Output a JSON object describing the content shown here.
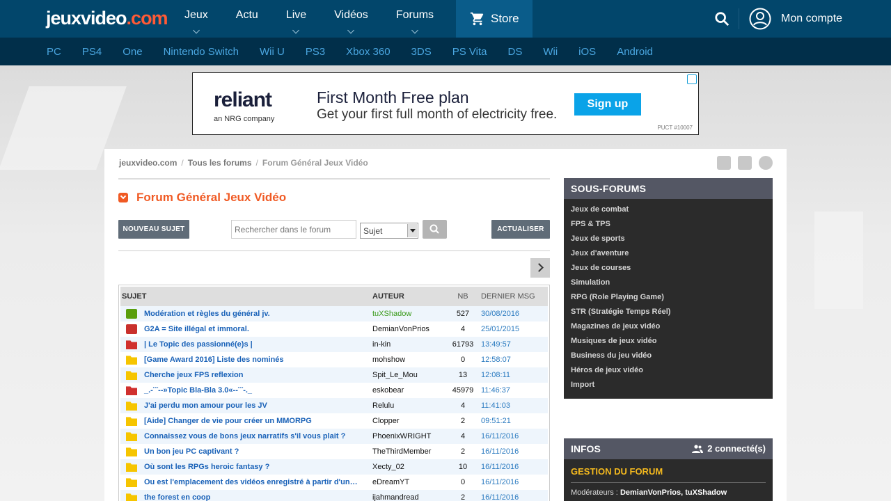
{
  "header": {
    "logo_main": "jeuxvideo",
    "logo_suffix": ".com",
    "nav": [
      {
        "label": "Jeux",
        "has_menu": true
      },
      {
        "label": "Actu",
        "has_menu": false
      },
      {
        "label": "Live",
        "has_menu": true
      },
      {
        "label": "Vidéos",
        "has_menu": true
      },
      {
        "label": "Forums",
        "has_menu": true
      }
    ],
    "store_label": "Store",
    "account_label": "Mon compte"
  },
  "platforms": [
    "PC",
    "PS4",
    "One",
    "Nintendo Switch",
    "Wii U",
    "PS3",
    "Xbox 360",
    "3DS",
    "PS Vita",
    "DS",
    "Wii",
    "iOS",
    "Android"
  ],
  "ad": {
    "brand": "reliant",
    "brand_sub": "an NRG company",
    "headline": "First Month Free plan",
    "subline": "Get your first full month of electricity free.",
    "cta": "Sign up",
    "fine_print": "PUCT #10007"
  },
  "breadcrumb": [
    "jeuxvideo.com",
    "Tous les forums",
    "Forum Général Jeux Vidéo"
  ],
  "forum": {
    "title": "Forum Général Jeux Vidéo",
    "new_topic": "NOUVEAU SUJET",
    "search_placeholder": "Rechercher dans le forum",
    "search_scope": "Sujet",
    "refresh": "ACTUALISER"
  },
  "table": {
    "headers": {
      "subject": "SUJET",
      "author": "AUTEUR",
      "nb": "NB",
      "last": "DERNIER MSG"
    },
    "rows": [
      {
        "icon": "pin-green",
        "subject": "Modération et règles du général jv.",
        "author": "tuXShadow",
        "author_mod": true,
        "nb": "527",
        "last": "30/08/2016"
      },
      {
        "icon": "pin-red",
        "subject": "G2A = Site illégal et immoral.",
        "author": "DemianVonPrios",
        "author_mod": false,
        "nb": "4",
        "last": "25/01/2015"
      },
      {
        "icon": "folder-red",
        "subject": "| Le Topic des passionné(e)s |",
        "author": "in-kin",
        "author_mod": false,
        "nb": "61793",
        "last": "13:49:57"
      },
      {
        "icon": "folder-yellow",
        "subject": "[Game Award 2016] Liste des nominés",
        "author": "mohshow",
        "author_mod": false,
        "nb": "0",
        "last": "12:58:07"
      },
      {
        "icon": "folder-yellow",
        "subject": "Cherche jeux FPS reflexion",
        "author": "Spit_Le_Mou",
        "author_mod": false,
        "nb": "13",
        "last": "12:08:11"
      },
      {
        "icon": "folder-red",
        "subject": "_.-¨¨--»Topic Bla-Bla 3.0«--¨¨-._",
        "author": "eskobear",
        "author_mod": false,
        "nb": "45979",
        "last": "11:46:37"
      },
      {
        "icon": "folder-yellow",
        "subject": "J'ai perdu mon amour pour les JV",
        "author": "Relulu",
        "author_mod": false,
        "nb": "4",
        "last": "11:41:03"
      },
      {
        "icon": "folder-yellow",
        "subject": "[Aide] Changer de vie pour créer un MMORPG",
        "author": "Clopper",
        "author_mod": false,
        "nb": "2",
        "last": "09:51:21"
      },
      {
        "icon": "folder-yellow",
        "subject": "Connaissez vous de bons jeux narratifs s'il vous plait ?",
        "author": "PhoenixWRIGHT",
        "author_mod": false,
        "nb": "4",
        "last": "16/11/2016"
      },
      {
        "icon": "folder-yellow",
        "subject": "Un bon jeu PC captivant ?",
        "author": "TheThirdMember",
        "author_mod": false,
        "nb": "2",
        "last": "16/11/2016"
      },
      {
        "icon": "folder-yellow",
        "subject": "Où sont les RPGs heroic fantasy ?",
        "author": "Xecty_02",
        "author_mod": false,
        "nb": "10",
        "last": "16/11/2016"
      },
      {
        "icon": "folder-yellow",
        "subject": "Ou est l'emplacement des vidéos enregistré à partir d'un…",
        "author": "eDreamYT",
        "author_mod": false,
        "nb": "0",
        "last": "16/11/2016"
      },
      {
        "icon": "folder-yellow",
        "subject": "the forest en coop",
        "author": "ijahmandread",
        "author_mod": false,
        "nb": "2",
        "last": "16/11/2016"
      }
    ]
  },
  "subforums": {
    "title": "SOUS-FORUMS",
    "items": [
      "Jeux de combat",
      "FPS & TPS",
      "Jeux de sports",
      "Jeux d'aventure",
      "Jeux de courses",
      "Simulation",
      "RPG (Role Playing Game)",
      "STR (Stratégie Temps Réel)",
      "Magazines de jeux vidéo",
      "Musiques de jeux vidéo",
      "Business du jeu vidéo",
      "Héros de jeux vidéo",
      "Import"
    ]
  },
  "infos": {
    "title": "INFOS",
    "connected": "2 connecté(s)",
    "management": "GESTION DU FORUM",
    "mods_label": "Modérateurs :",
    "mods_names": "DemianVonPrios, tuXShadow"
  },
  "colors": {
    "header": "#02466b",
    "platbar": "#012f4a",
    "accent": "#f05a24",
    "link": "#1a62b8"
  }
}
